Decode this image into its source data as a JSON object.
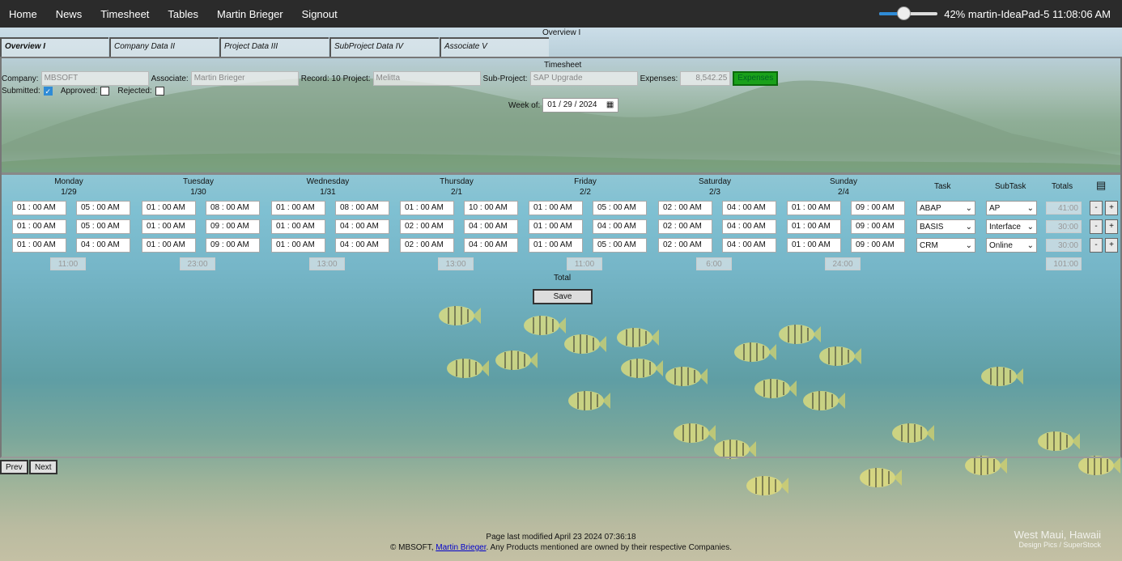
{
  "nav": [
    "Home",
    "News",
    "Timesheet",
    "Tables",
    "Martin Brieger",
    "Signout"
  ],
  "status": {
    "brightness_label": "42%",
    "brightness": 0.42,
    "host": "martin-IdeaPad-5",
    "time": "11:08:06 AM"
  },
  "tabs": {
    "caption": "Overview I",
    "items": [
      "Overview I",
      "Company Data II",
      "Project Data III",
      "SubProject Data IV",
      "Associate V"
    ]
  },
  "sheet": {
    "title": "Timesheet",
    "company_label": "Company:",
    "company": "MBSOFT",
    "associate_label": "Associate:",
    "associate": "Martin Brieger",
    "record": "Record: 10",
    "project_label": "Project:",
    "project": "Melitta",
    "subproject_label": "Sub-Project:",
    "subproject": "SAP Upgrade",
    "expenses_label": "Expenses:",
    "expenses": "8,542.25",
    "expenses_button": "Expenses",
    "submitted_label": "Submitted:",
    "approved_label": "Approved:",
    "rejected_label": "Rejected:",
    "submitted": true,
    "approved": false,
    "rejected": false,
    "week_label": "Week of:",
    "week_date": "01 / 29 / 2024"
  },
  "grid": {
    "days": [
      {
        "name": "Monday",
        "date": "1/29",
        "total": "11:00"
      },
      {
        "name": "Tuesday",
        "date": "1/30",
        "total": "23:00"
      },
      {
        "name": "Wednesday",
        "date": "1/31",
        "total": "13:00"
      },
      {
        "name": "Thursday",
        "date": "2/1",
        "total": "13:00"
      },
      {
        "name": "Friday",
        "date": "2/2",
        "total": "11:00"
      },
      {
        "name": "Saturday",
        "date": "2/3",
        "total": "6:00"
      },
      {
        "name": "Sunday",
        "date": "2/4",
        "total": "24:00"
      }
    ],
    "task_header": "Task",
    "subtask_header": "SubTask",
    "totals_header": "Totals",
    "rows": [
      {
        "times": [
          "01 : 00 AM",
          "05 : 00 AM",
          "01 : 00 AM",
          "08 : 00 AM",
          "01 : 00 AM",
          "08 : 00 AM",
          "01 : 00 AM",
          "10 : 00 AM",
          "01 : 00 AM",
          "05 : 00 AM",
          "02 : 00 AM",
          "04 : 00 AM",
          "01 : 00 AM",
          "09 : 00 AM"
        ],
        "task": "ABAP",
        "subtask": "AP",
        "total": "41:00"
      },
      {
        "times": [
          "01 : 00 AM",
          "05 : 00 AM",
          "01 : 00 AM",
          "09 : 00 AM",
          "01 : 00 AM",
          "04 : 00 AM",
          "02 : 00 AM",
          "04 : 00 AM",
          "01 : 00 AM",
          "04 : 00 AM",
          "02 : 00 AM",
          "04 : 00 AM",
          "01 : 00 AM",
          "09 : 00 AM"
        ],
        "task": "BASIS",
        "subtask": "Interface",
        "total": "30:00"
      },
      {
        "times": [
          "01 : 00 AM",
          "04 : 00 AM",
          "01 : 00 AM",
          "09 : 00 AM",
          "01 : 00 AM",
          "04 : 00 AM",
          "02 : 00 AM",
          "04 : 00 AM",
          "01 : 00 AM",
          "05 : 00 AM",
          "02 : 00 AM",
          "04 : 00 AM",
          "01 : 00 AM",
          "09 : 00 AM"
        ],
        "task": "CRM",
        "subtask": "Online",
        "total": "30:00"
      }
    ],
    "grand_total": "101:00",
    "total_label": "Total",
    "save": "Save",
    "minus": "-",
    "plus": "+"
  },
  "pager": {
    "prev": "Prev",
    "next": "Next"
  },
  "footer": {
    "modified": "Page last modified April 23 2024 07:36:18",
    "copy_pre": "© MBSOFT, ",
    "copy_link": "Martin Brieger",
    "copy_post": ". Any Products mentioned are owned by their respective Companies."
  },
  "credit": {
    "place": "West Maui, Hawaii",
    "source": "Design Pics / SuperStock"
  }
}
